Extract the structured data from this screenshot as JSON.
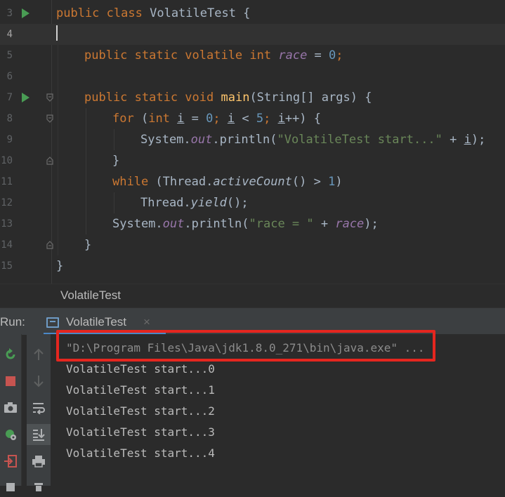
{
  "editor": {
    "line_numbers": [
      "3",
      "4",
      "5",
      "6",
      "7",
      "8",
      "9",
      "10",
      "11",
      "12",
      "13",
      "14",
      "15"
    ],
    "code": {
      "l3": {
        "kw1": "public",
        "kw2": "class",
        "name": "VolatileTest",
        "brace": " {"
      },
      "l5": {
        "kw": "public static volatile int",
        "var": "race",
        "eq": " = ",
        "num": "0",
        "semi": ";"
      },
      "l7": {
        "kw": "public static void",
        "fn": "main",
        "rest": "(String[] args) {"
      },
      "l8": {
        "kw": "for",
        "open": " (",
        "type": "int",
        "v1": "i",
        "mid1": " = ",
        "n0": "0",
        "semi1": "; ",
        "v2": "i",
        "mid2": " < ",
        "n5": "5",
        "semi2": "; ",
        "v3": "i",
        "end": "++) {"
      },
      "l9": {
        "pre": "System.",
        "out": "out",
        "mid": ".println(",
        "str": "\"VolatileTest start...\"",
        "plus": " + ",
        "v": "i",
        "end": ");"
      },
      "l10": {
        "text": "}"
      },
      "l11": {
        "kw": "while",
        "pre": " (Thread.",
        "fn": "activeCount",
        "mid": "() > ",
        "num": "1",
        "end": ")"
      },
      "l12": {
        "pre": "Thread.",
        "fn": "yield",
        "end": "();"
      },
      "l13": {
        "pre": "System.",
        "out": "out",
        "mid": ".println(",
        "str": "\"race = \"",
        "plus": " + ",
        "var": "race",
        "end": ");"
      },
      "l14": {
        "text": "}"
      },
      "l15": {
        "text": "}"
      }
    }
  },
  "breadcrumb": {
    "label": "VolatileTest"
  },
  "run_panel": {
    "label": "Run:",
    "tab_label": "VolatileTest",
    "tab_close": "×",
    "icons": {
      "left": [
        "rerun-icon",
        "stop-icon",
        "camera-icon",
        "debug-settings-icon",
        "exit-icon"
      ],
      "right": [
        "up-arrow-icon",
        "down-arrow-icon",
        "soft-wrap-icon",
        "scroll-to-end-icon",
        "print-icon"
      ]
    },
    "console_lines": [
      "\"D:\\Program Files\\Java\\jdk1.8.0_271\\bin\\java.exe\" ...",
      "VolatileTest start...0",
      "VolatileTest start...1",
      "VolatileTest start...2",
      "VolatileTest start...3",
      "VolatileTest start...4"
    ],
    "highlight_color": "#e5261f"
  }
}
